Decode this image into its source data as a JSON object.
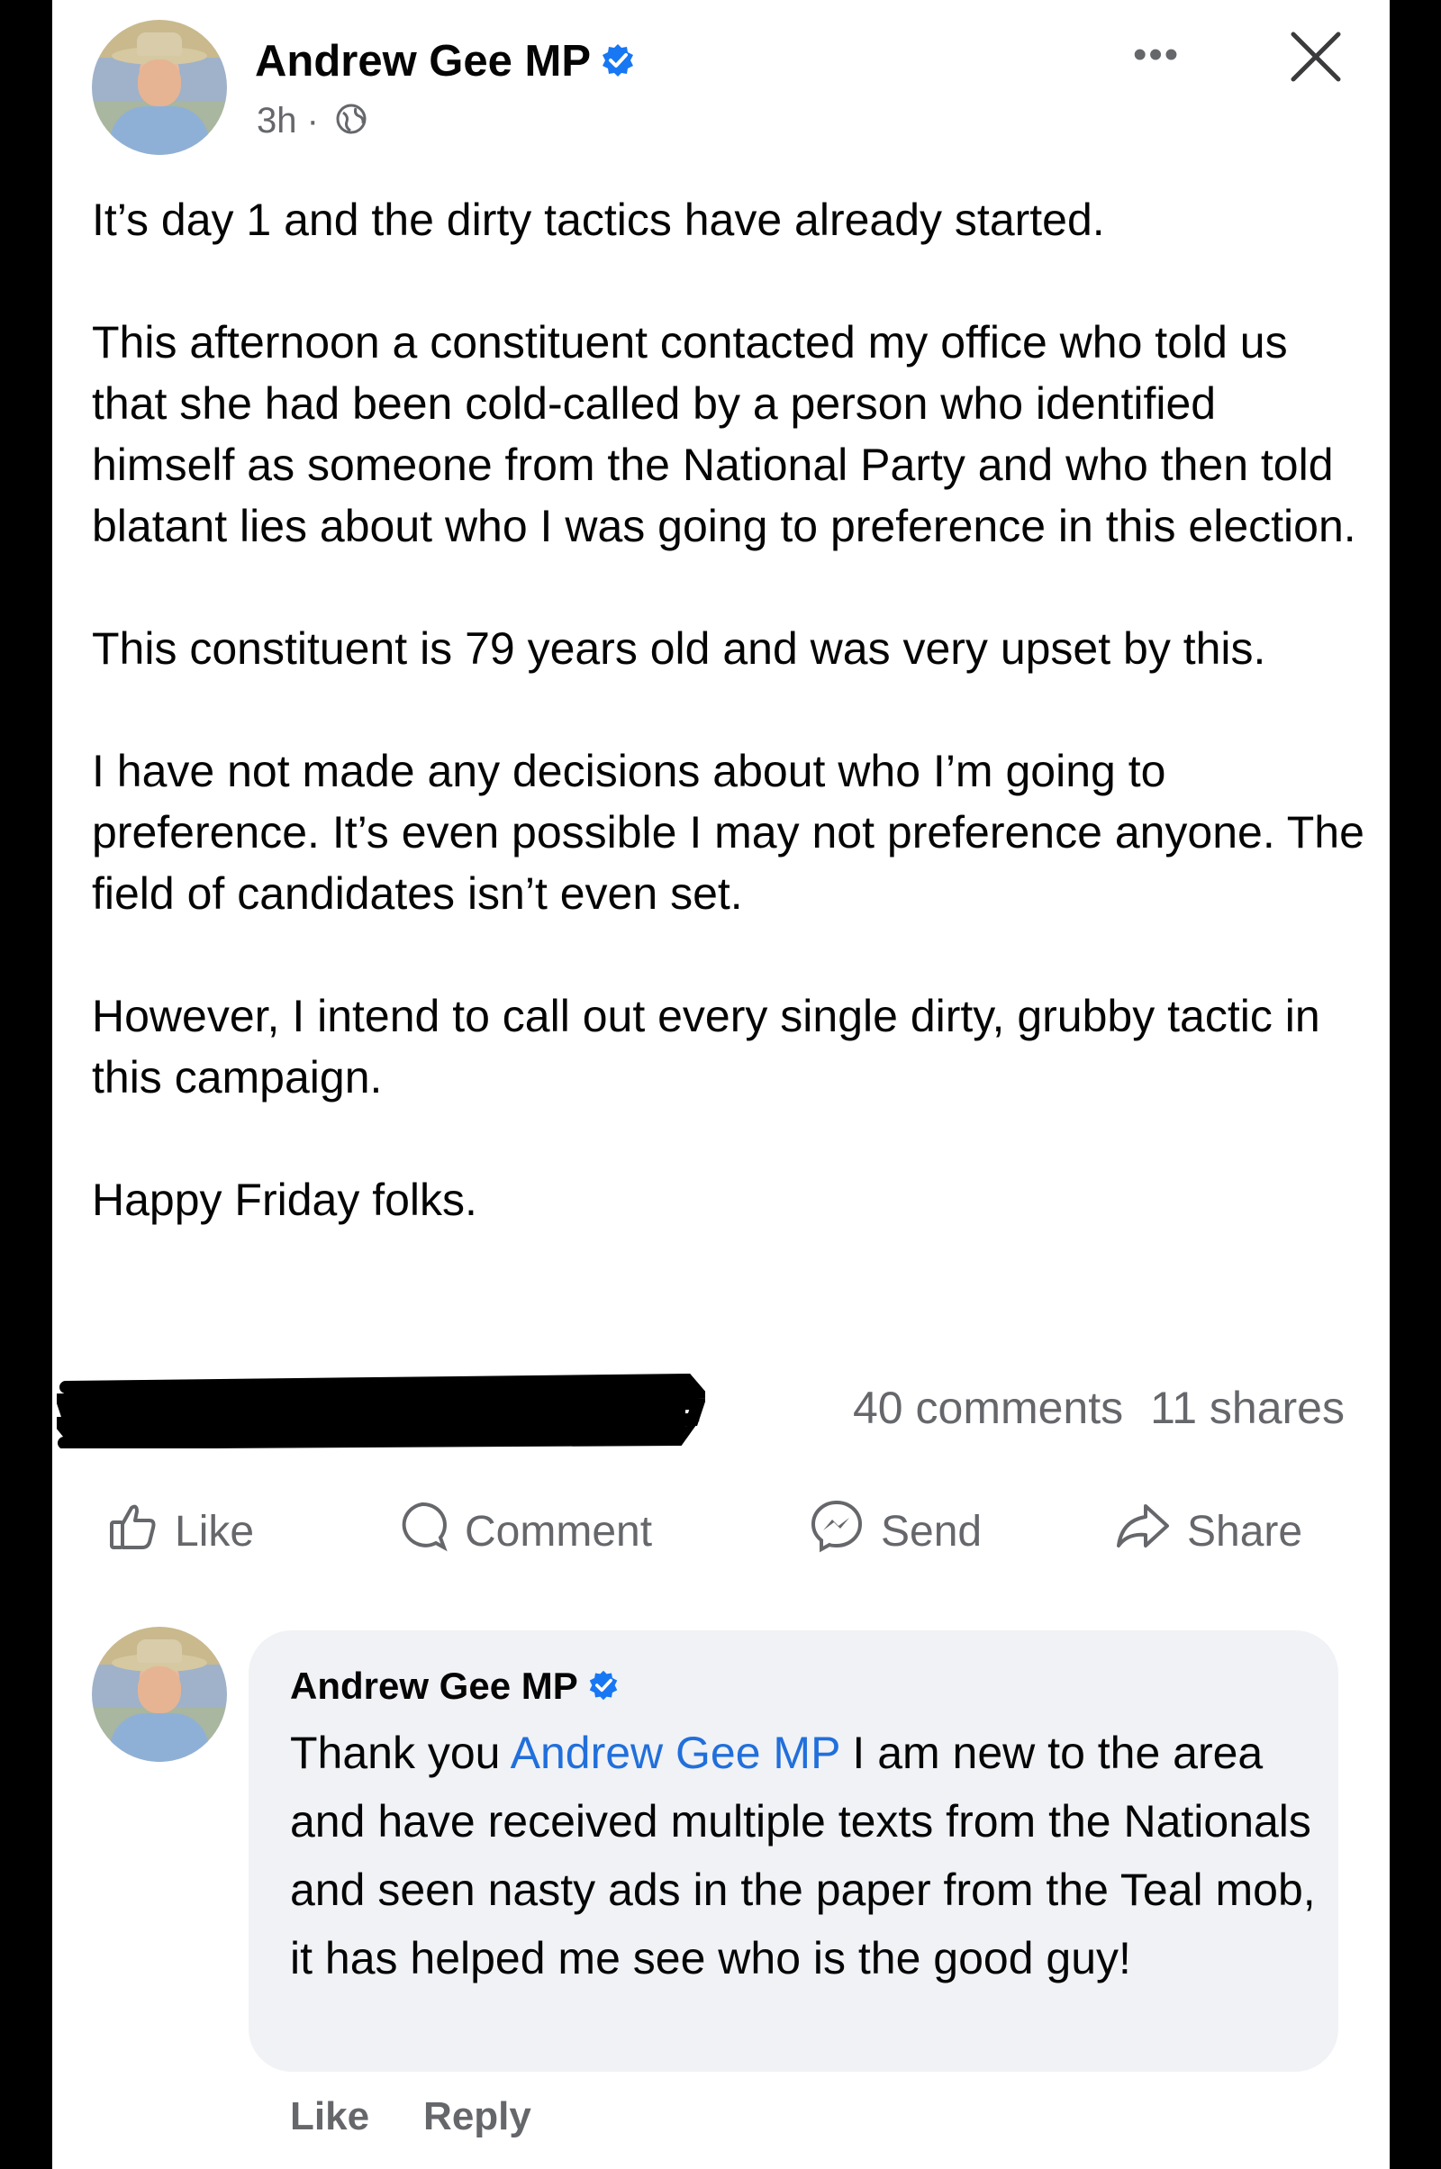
{
  "post": {
    "author": "Andrew Gee MP",
    "time": "3h",
    "separator": "·",
    "more_label": "•••",
    "paragraphs": [
      "It’s day 1 and the dirty tactics have already started.",
      "This afternoon a constituent contacted my office who told us that she had been cold-called by a person who identified himself as someone from the National Party and who then told blatant lies about who I was going to preference in this election.",
      "This constituent is 79 years old and was very upset by this.",
      "I have not made any decisions about who I’m going to preference. It’s even possible I may not preference anyone. The field of candidates isn’t even set.",
      "However, I intend to call out every single dirty, grubby tactic in this campaign.",
      "Happy Friday folks."
    ],
    "comments_count": "40 comments",
    "shares_count": "11 shares"
  },
  "actions": {
    "like": "Like",
    "comment": "Comment",
    "send": "Send",
    "share": "Share"
  },
  "comment": {
    "author": "Andrew Gee MP",
    "text_before": "Thank you ",
    "mention": "Andrew Gee MP",
    "text_after": " I am new to the area and have received multiple texts from the Nationals and seen nasty ads in the paper from the Teal mob, it has helped me see who is the good guy!",
    "like_label": "Like",
    "reply_label": "Reply"
  },
  "colors": {
    "verified": "#1877f2",
    "mention": "#216fdb",
    "muted": "#65676b"
  }
}
